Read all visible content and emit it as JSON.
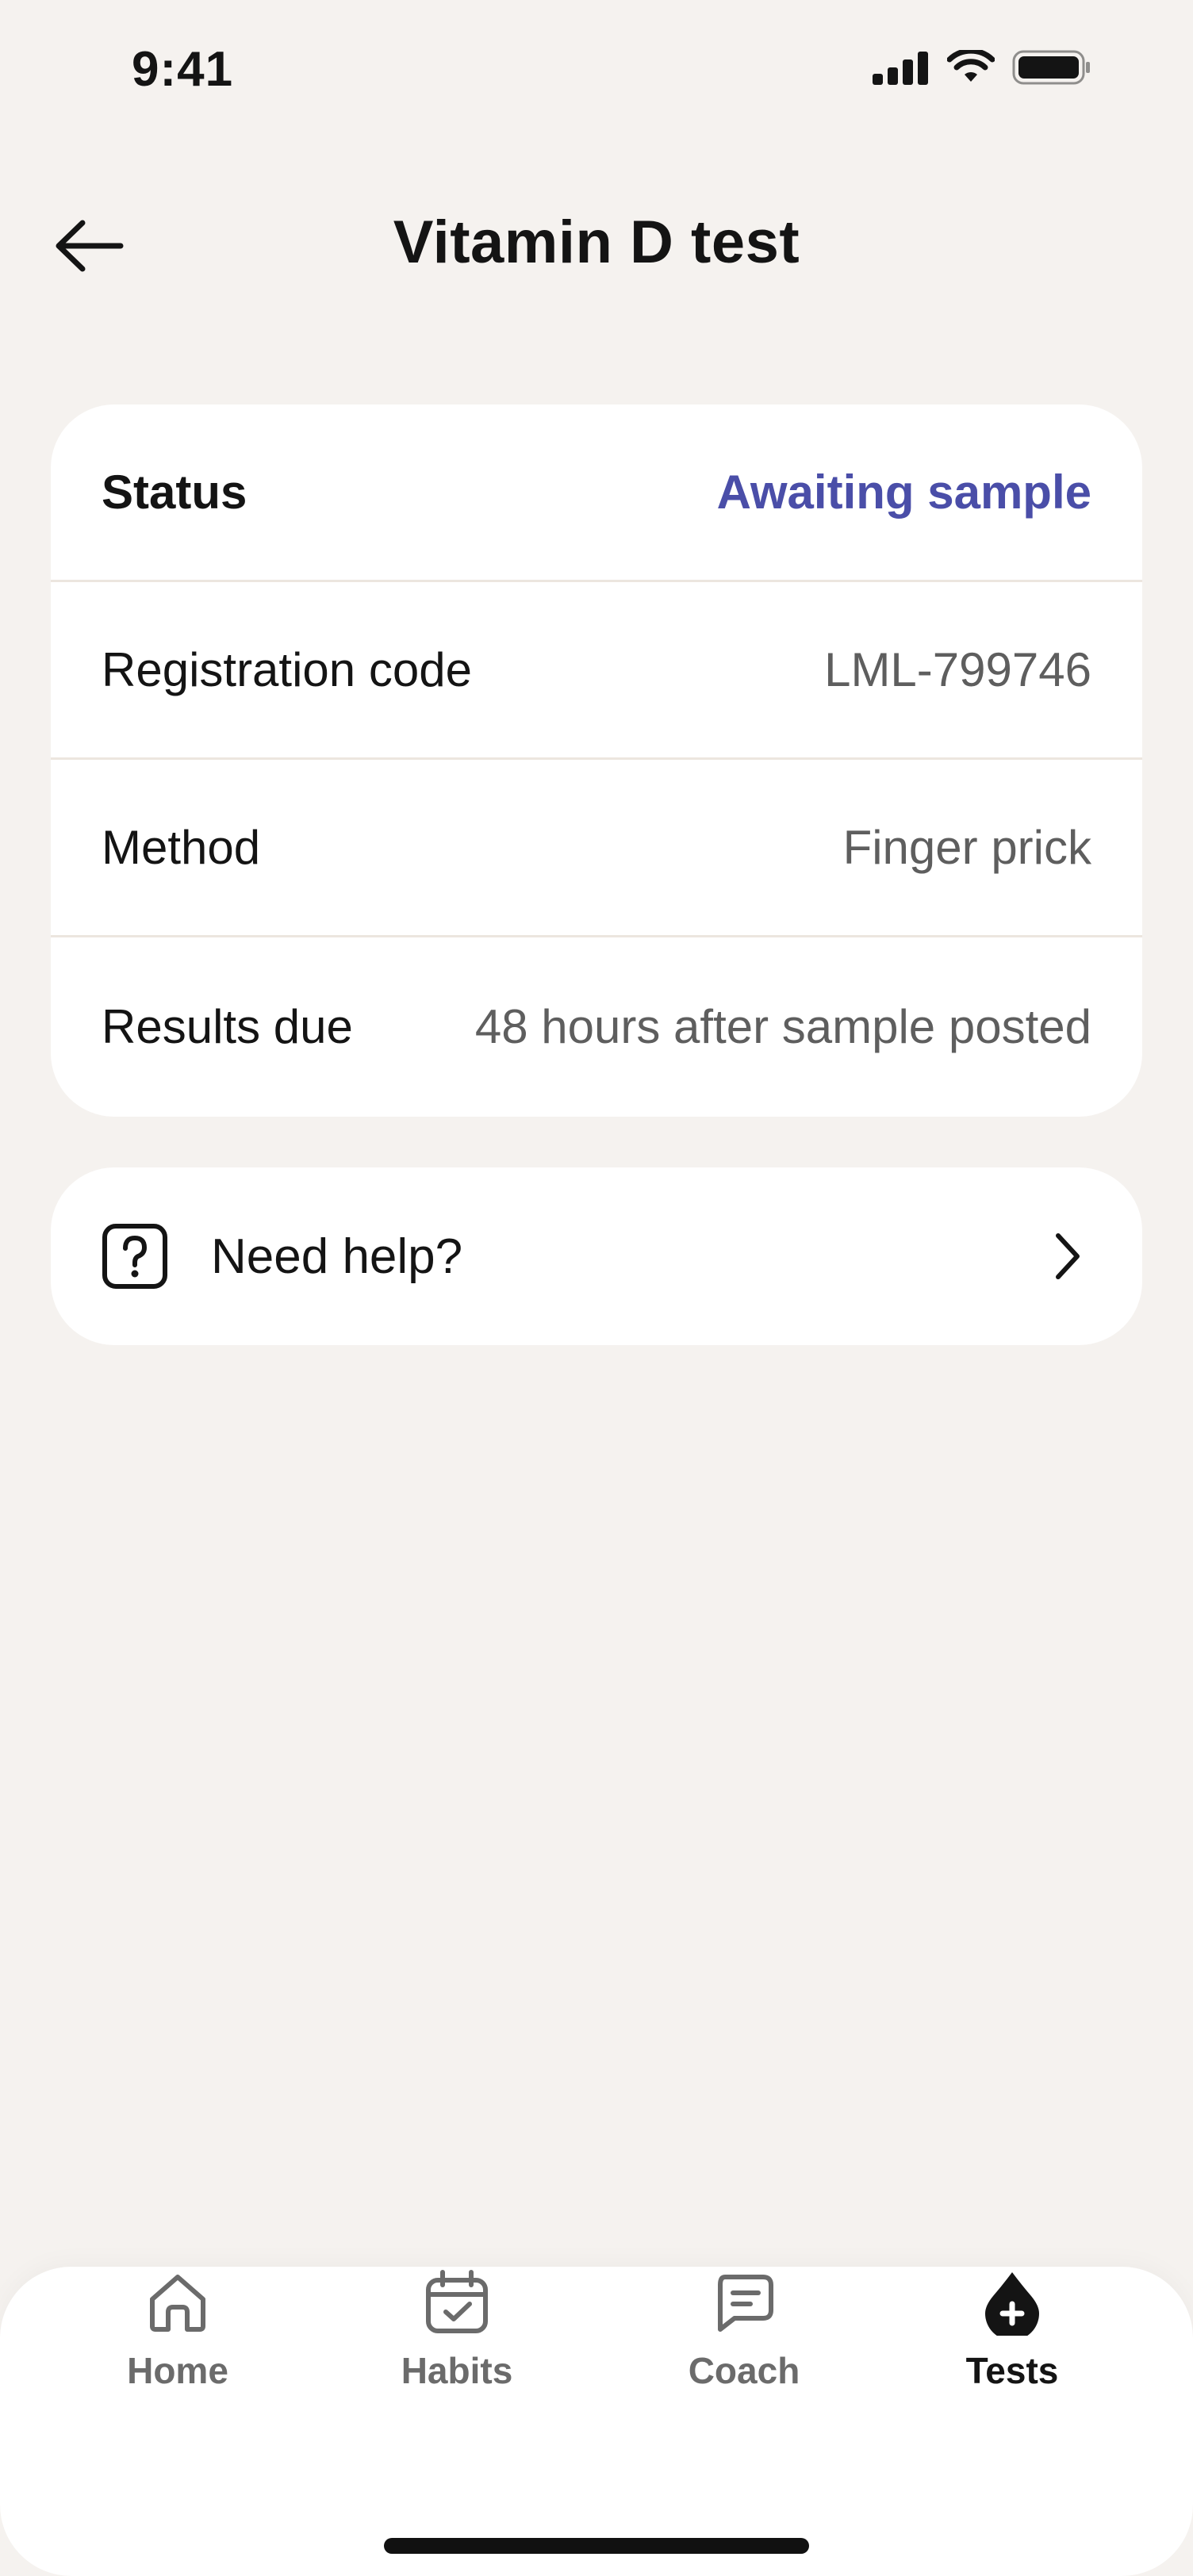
{
  "status_bar": {
    "time": "9:41"
  },
  "header": {
    "title": "Vitamin D test"
  },
  "details": [
    {
      "label": "Status",
      "value": "Awaiting sample"
    },
    {
      "label": "Registration code",
      "value": "LML-799746"
    },
    {
      "label": "Method",
      "value": "Finger prick"
    },
    {
      "label": "Results due",
      "value": "48 hours after sample posted"
    }
  ],
  "help": {
    "label": "Need help?"
  },
  "tabs": [
    {
      "label": "Home",
      "icon": "home-icon"
    },
    {
      "label": "Habits",
      "icon": "calendar-check-icon"
    },
    {
      "label": "Coach",
      "icon": "chat-icon"
    },
    {
      "label": "Tests",
      "icon": "blood-drop-plus-icon",
      "active": true
    }
  ],
  "colors": {
    "background": "#F5F2EF",
    "card": "#FFFFFF",
    "status_accent": "#4A4EA8",
    "text": "#141414",
    "muted": "#5E5E5E"
  }
}
